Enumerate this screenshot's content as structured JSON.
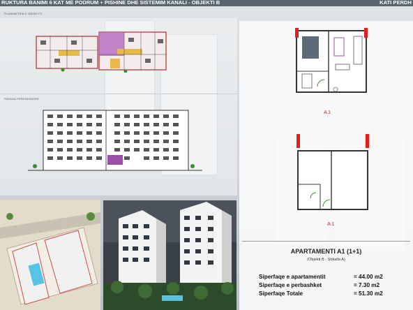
{
  "header": {
    "title": "RUKTURA BANIMI 6 KAT ME PODRUM + PISHINE DHE SISTEMIM KANALI   -  OBJEKTI B",
    "right": "KATI PERDH"
  },
  "plans": {
    "top_label": "PLANIMETRIA E OBJEKTIT",
    "facade_label": "FASADA PERENDIMORE"
  },
  "apartment": {
    "plan_label_top": "A1",
    "plan_label_bottom": "A1",
    "title": "APARTAMENTI A1 (1+1)",
    "subtitle": "(Objekti B - Shkalla A)",
    "rows": [
      {
        "label": "Siperfaqe e apartamentit",
        "value": "= 44.00 m2"
      },
      {
        "label": "Siperfaqe e perbashket",
        "value": "=  7.30 m2"
      },
      {
        "label": "Siperfaqe Totale",
        "value": "= 51.30 m2"
      }
    ]
  },
  "colors": {
    "accent_red": "#d02020",
    "purple": "#9b4fa8",
    "header": "#59636e"
  }
}
